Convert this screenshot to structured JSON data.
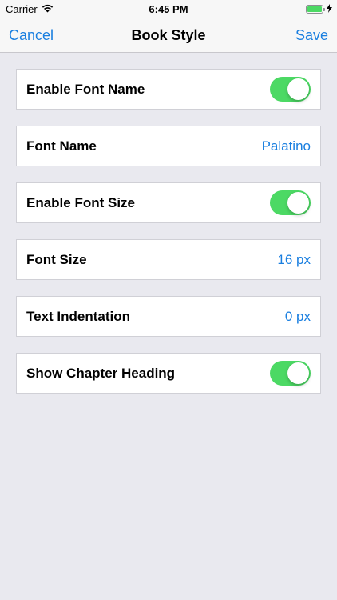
{
  "status": {
    "carrier": "Carrier",
    "time": "6:45 PM",
    "battery_level": 1.0
  },
  "nav": {
    "cancel": "Cancel",
    "title": "Book Style",
    "save": "Save"
  },
  "rows": [
    {
      "label": "Enable Font Name",
      "type": "toggle",
      "on": true
    },
    {
      "label": "Font Name",
      "type": "value",
      "value": "Palatino"
    },
    {
      "label": "Enable Font Size",
      "type": "toggle",
      "on": true
    },
    {
      "label": "Font Size",
      "type": "value",
      "value": "16 px"
    },
    {
      "label": "Text Indentation",
      "type": "value",
      "value": "0 px"
    },
    {
      "label": "Show Chapter Heading",
      "type": "toggle",
      "on": true
    }
  ],
  "colors": {
    "accent": "#1a7fe0",
    "toggle_on": "#4cd964",
    "background": "#e9e9ef"
  }
}
